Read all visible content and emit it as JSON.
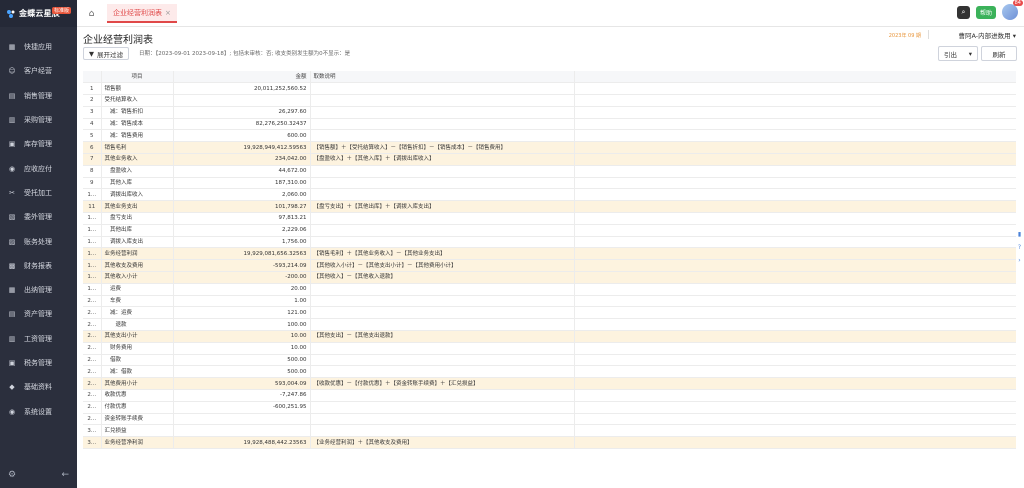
{
  "brand": {
    "name": "金蝶云星辰",
    "badge": "标准版"
  },
  "sidebar": {
    "items": [
      {
        "label": "快捷应用",
        "icon": "grid-icon"
      },
      {
        "label": "客户经营",
        "icon": "customer-icon"
      },
      {
        "label": "销售管理",
        "icon": "sales-icon"
      },
      {
        "label": "采购管理",
        "icon": "purchase-icon"
      },
      {
        "label": "库存管理",
        "icon": "inventory-icon"
      },
      {
        "label": "应收应付",
        "icon": "ar-ap-icon"
      },
      {
        "label": "受托加工",
        "icon": "processing-icon"
      },
      {
        "label": "委外管理",
        "icon": "outsource-icon"
      },
      {
        "label": "账务处理",
        "icon": "ledger-icon"
      },
      {
        "label": "财务报表",
        "icon": "report-icon"
      },
      {
        "label": "出纳管理",
        "icon": "cashier-icon"
      },
      {
        "label": "资产管理",
        "icon": "asset-icon"
      },
      {
        "label": "工资管理",
        "icon": "payroll-icon"
      },
      {
        "label": "税务管理",
        "icon": "tax-icon"
      },
      {
        "label": "基础资料",
        "icon": "base-data-icon"
      },
      {
        "label": "系统设置",
        "icon": "settings-icon"
      }
    ]
  },
  "topbar": {
    "tab_label": "企业经营利润表",
    "tab_close": "×",
    "help_label": "帮助",
    "avatar_badge": "84"
  },
  "header": {
    "title": "企业经营利润表",
    "period": "2023年 09 期",
    "company": "曹阿A-内部进数用",
    "filter_button": "展开过滤",
    "filter_info": "日期：【2023-09-01 2023-09-18】; 包括未审核：否; 收支类别发生额为0不显示：是",
    "export_button": "引出",
    "refresh_button": "刷新"
  },
  "table": {
    "columns": [
      "",
      "项目",
      "金额",
      "取数说明",
      ""
    ],
    "rows": [
      {
        "no": "1",
        "item": "销售额",
        "amount": "20,011,252,560.52",
        "note": "",
        "hl": false
      },
      {
        "no": "2",
        "item": "受托结算收入",
        "amount": "",
        "note": "",
        "hl": false
      },
      {
        "no": "3",
        "item": "　减：销售折扣",
        "amount": "26,297.60",
        "note": "",
        "hl": false
      },
      {
        "no": "4",
        "item": "　减：销售成本",
        "amount": "82,276,250.32437",
        "note": "",
        "hl": false
      },
      {
        "no": "5",
        "item": "　减：销售费用",
        "amount": "600.00",
        "note": "",
        "hl": false
      },
      {
        "no": "6",
        "item": "销售毛利",
        "amount": "19,928,949,412.59563",
        "note": "【销售额】＋【受托结算收入】－【销售折扣】－【销售成本】－【销售费用】",
        "hl": true
      },
      {
        "no": "7",
        "item": "其他业务收入",
        "amount": "234,042.00",
        "note": "【盘盈收入】＋【其他入库】＋【调拨出库收入】",
        "hl": true
      },
      {
        "no": "8",
        "item": "　盘盈收入",
        "amount": "44,672.00",
        "note": "",
        "hl": false
      },
      {
        "no": "9",
        "item": "　其他入库",
        "amount": "187,310.00",
        "note": "",
        "hl": false
      },
      {
        "no": "1...",
        "item": "　调拨出库收入",
        "amount": "2,060.00",
        "note": "",
        "hl": false
      },
      {
        "no": "11",
        "item": "其他业务支出",
        "amount": "101,798.27",
        "note": "【盘亏支出】＋【其他出库】＋【调拨入库支出】",
        "hl": true
      },
      {
        "no": "1...",
        "item": "　盘亏支出",
        "amount": "97,813.21",
        "note": "",
        "hl": false
      },
      {
        "no": "1...",
        "item": "　其他出库",
        "amount": "2,229.06",
        "note": "",
        "hl": false
      },
      {
        "no": "1...",
        "item": "　调拨入库支出",
        "amount": "1,756.00",
        "note": "",
        "hl": false
      },
      {
        "no": "1...",
        "item": "业务经营利润",
        "amount": "19,929,081,656.32563",
        "note": "【销售毛利】＋【其他业务收入】－【其他业务支出】",
        "hl": true
      },
      {
        "no": "1...",
        "item": "其他收支及费用",
        "amount": "-593,214.09",
        "note": "【其他收入小计】－【其他支出小计】－【其他费用小计】",
        "hl": true
      },
      {
        "no": "1...",
        "item": "其他收入小计",
        "amount": "-200.00",
        "note": "【其他收入】－【其他收入退款】",
        "hl": true
      },
      {
        "no": "1...",
        "item": "　运费",
        "amount": "20.00",
        "note": "",
        "hl": false
      },
      {
        "no": "2...",
        "item": "　车费",
        "amount": "1.00",
        "note": "",
        "hl": false
      },
      {
        "no": "2...",
        "item": "　减：运费",
        "amount": "121.00",
        "note": "",
        "hl": false
      },
      {
        "no": "2...",
        "item": "　　退款",
        "amount": "100.00",
        "note": "",
        "hl": false
      },
      {
        "no": "2...",
        "item": "其他支出小计",
        "amount": "10.00",
        "note": "【其他支出】－【其他支出退款】",
        "hl": true
      },
      {
        "no": "2...",
        "item": "　财务费用",
        "amount": "10.00",
        "note": "",
        "hl": false
      },
      {
        "no": "2...",
        "item": "　借款",
        "amount": "500.00",
        "note": "",
        "hl": false
      },
      {
        "no": "2...",
        "item": "　减：借款",
        "amount": "500.00",
        "note": "",
        "hl": false
      },
      {
        "no": "2...",
        "item": "其他费用小计",
        "amount": "593,004.09",
        "note": "【收款优惠】－【付款优惠】＋【资金转账手续费】＋【汇兑损益】",
        "hl": true
      },
      {
        "no": "2...",
        "item": "收款优惠",
        "amount": "-7,247.86",
        "note": "",
        "hl": false
      },
      {
        "no": "2...",
        "item": "付款优惠",
        "amount": "-600,251.95",
        "note": "",
        "hl": false
      },
      {
        "no": "2...",
        "item": "资金转账手续费",
        "amount": "",
        "note": "",
        "hl": false
      },
      {
        "no": "3...",
        "item": "汇兑损益",
        "amount": "",
        "note": "",
        "hl": false
      },
      {
        "no": "3...",
        "item": "业务经营净利润",
        "amount": "19,928,488,442.23563",
        "note": "【业务经营利润】＋【其他收支及费用】",
        "hl": true
      }
    ]
  },
  "colors": {
    "sidebar_bg": "#2b2f3d",
    "highlight_row": "#fdf3df",
    "accent_red": "#e04848",
    "help_green": "#3bb25a"
  }
}
